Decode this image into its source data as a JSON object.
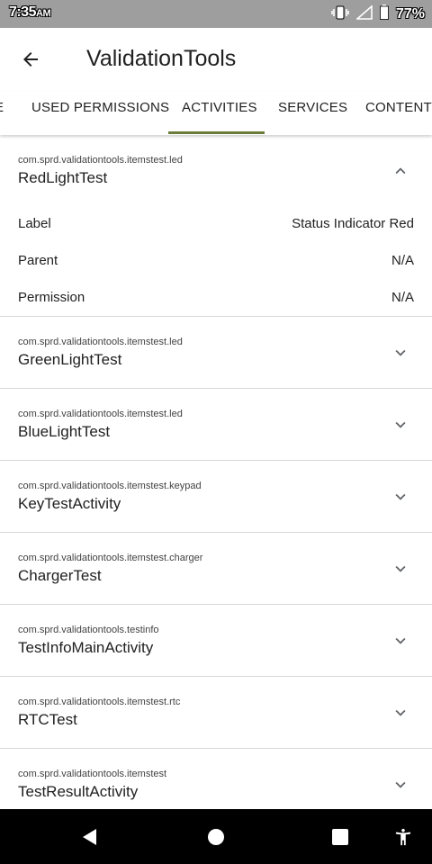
{
  "status_bar": {
    "time": "7:35",
    "ampm": "AM",
    "battery": "77%",
    "icons": [
      "vibrate-icon",
      "signal-icon",
      "battery-icon"
    ]
  },
  "app_bar": {
    "title": "ValidationTools",
    "back_icon": "arrow-back-icon"
  },
  "tabs": [
    {
      "label": "E"
    },
    {
      "label": "USED PERMISSIONS"
    },
    {
      "label": "ACTIVITIES",
      "selected": true
    },
    {
      "label": "SERVICES"
    },
    {
      "label": "CONTENT P"
    }
  ],
  "accent_color": "#6a7d3a",
  "activities": [
    {
      "package": "com.sprd.validationtools.itemstest.led",
      "name": "RedLightTest",
      "expanded": true,
      "details": [
        {
          "label": "Label",
          "value": "Status Indicator Red"
        },
        {
          "label": "Parent",
          "value": "N/A"
        },
        {
          "label": "Permission",
          "value": "N/A"
        }
      ]
    },
    {
      "package": "com.sprd.validationtools.itemstest.led",
      "name": "GreenLightTest"
    },
    {
      "package": "com.sprd.validationtools.itemstest.led",
      "name": "BlueLightTest"
    },
    {
      "package": "com.sprd.validationtools.itemstest.keypad",
      "name": "KeyTestActivity"
    },
    {
      "package": "com.sprd.validationtools.itemstest.charger",
      "name": "ChargerTest"
    },
    {
      "package": "com.sprd.validationtools.testinfo",
      "name": "TestInfoMainActivity"
    },
    {
      "package": "com.sprd.validationtools.itemstest.rtc",
      "name": "RTCTest"
    },
    {
      "package": "com.sprd.validationtools.itemstest",
      "name": "TestResultActivity"
    }
  ],
  "nav_bar": [
    "back-triangle-icon",
    "home-circle-icon",
    "recents-square-icon",
    "accessibility-icon"
  ]
}
